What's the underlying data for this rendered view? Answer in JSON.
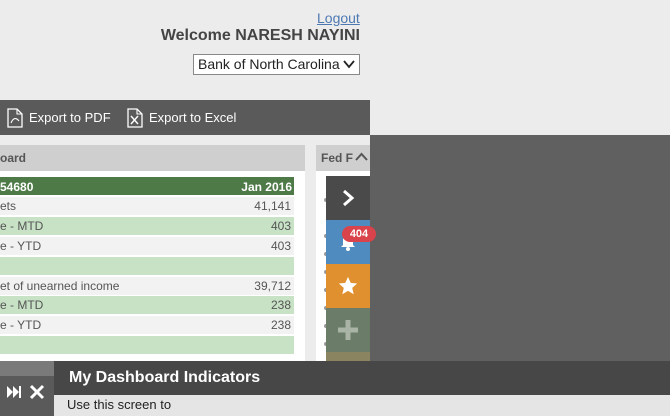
{
  "header": {
    "logout_label": "Logout",
    "welcome_text": "Welcome  NARESH NAYINI",
    "bank_select_value": "Bank of North Carolina"
  },
  "toolbar": {
    "export_pdf_label": "Export to PDF",
    "export_excel_label": "Export to Excel"
  },
  "dashboard_panel": {
    "title": "oard",
    "id_cell": "54680",
    "period": "Jan 2016",
    "rows": [
      {
        "label": "ets",
        "value": "41,141"
      },
      {
        "label": "e - MTD",
        "value": "403"
      },
      {
        "label": "e - YTD",
        "value": "403"
      },
      {
        "label": "",
        "value": ""
      },
      {
        "label": "et of unearned income",
        "value": "39,712"
      },
      {
        "label": "e - MTD",
        "value": "238"
      },
      {
        "label": "e - YTD",
        "value": "238"
      },
      {
        "label": "",
        "value": ""
      }
    ]
  },
  "fed_panel": {
    "title": "Fed F"
  },
  "side_menu": {
    "notification_count": "404",
    "colors": {
      "toggle": "#4a4a4a",
      "notifications": "#4f8bbf",
      "favorites": "#e0902f",
      "add": "#6b7d69",
      "extra": "#8a8560"
    }
  },
  "drawer": {
    "title": "My Dashboard Indicators",
    "body_text": "Use this screen to"
  }
}
